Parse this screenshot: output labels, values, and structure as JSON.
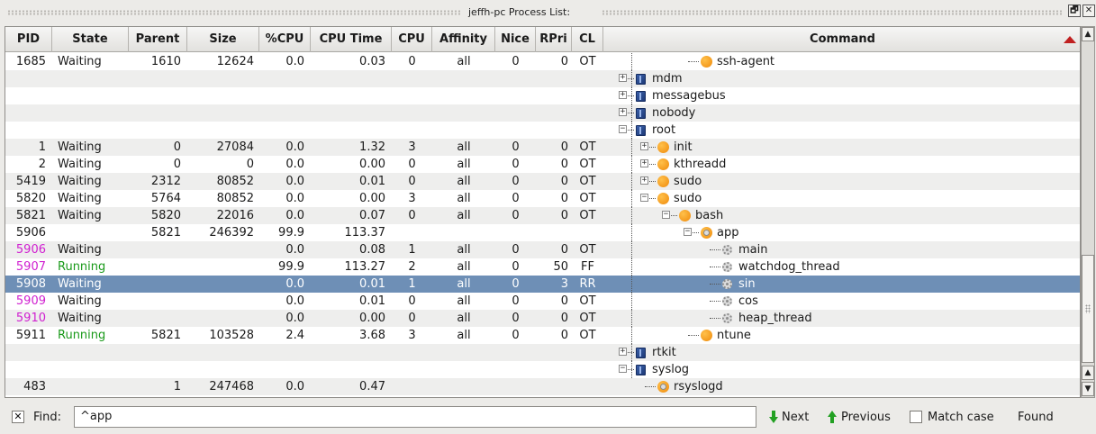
{
  "window": {
    "title": "jeffh-pc Process List:",
    "float_glyph": "🗗",
    "close_glyph": "✕"
  },
  "columns": [
    "PID",
    "State",
    "Parent",
    "Size",
    "%CPU",
    "CPU Time",
    "CPU",
    "Affinity",
    "Nice",
    "RPri",
    "CL",
    "Command"
  ],
  "sort": {
    "column": "Command",
    "direction": "descending",
    "indicator_color": "#c02020"
  },
  "rows": [
    {
      "pid": "1685",
      "state": "Waiting",
      "parent": "1610",
      "size": "12624",
      "cpu_pct": "0.0",
      "cpu_time": "0.03",
      "cpu": "0",
      "affinity": "all",
      "nice": "0",
      "rpri": "0",
      "cl": "OT",
      "command": "ssh-agent",
      "depth": 3,
      "icon": "process",
      "expander": "",
      "pid_color": "",
      "state_color": ""
    },
    {
      "pid": "",
      "state": "",
      "parent": "",
      "size": "",
      "cpu_pct": "",
      "cpu_time": "",
      "cpu": "",
      "affinity": "",
      "nice": "",
      "rpri": "",
      "cl": "",
      "command": "mdm",
      "depth": 0,
      "icon": "user",
      "expander": "+",
      "pid_color": "",
      "state_color": ""
    },
    {
      "pid": "",
      "state": "",
      "parent": "",
      "size": "",
      "cpu_pct": "",
      "cpu_time": "",
      "cpu": "",
      "affinity": "",
      "nice": "",
      "rpri": "",
      "cl": "",
      "command": "messagebus",
      "depth": 0,
      "icon": "user",
      "expander": "+",
      "pid_color": "",
      "state_color": ""
    },
    {
      "pid": "",
      "state": "",
      "parent": "",
      "size": "",
      "cpu_pct": "",
      "cpu_time": "",
      "cpu": "",
      "affinity": "",
      "nice": "",
      "rpri": "",
      "cl": "",
      "command": "nobody",
      "depth": 0,
      "icon": "user",
      "expander": "+",
      "pid_color": "",
      "state_color": ""
    },
    {
      "pid": "",
      "state": "",
      "parent": "",
      "size": "",
      "cpu_pct": "",
      "cpu_time": "",
      "cpu": "",
      "affinity": "",
      "nice": "",
      "rpri": "",
      "cl": "",
      "command": "root",
      "depth": 0,
      "icon": "user",
      "expander": "-",
      "pid_color": "",
      "state_color": ""
    },
    {
      "pid": "1",
      "state": "Waiting",
      "parent": "0",
      "size": "27084",
      "cpu_pct": "0.0",
      "cpu_time": "1.32",
      "cpu": "3",
      "affinity": "all",
      "nice": "0",
      "rpri": "0",
      "cl": "OT",
      "command": "init",
      "depth": 1,
      "icon": "process",
      "expander": "+",
      "pid_color": "",
      "state_color": ""
    },
    {
      "pid": "2",
      "state": "Waiting",
      "parent": "0",
      "size": "0",
      "cpu_pct": "0.0",
      "cpu_time": "0.00",
      "cpu": "0",
      "affinity": "all",
      "nice": "0",
      "rpri": "0",
      "cl": "OT",
      "command": "kthreadd",
      "depth": 1,
      "icon": "process",
      "expander": "+",
      "pid_color": "",
      "state_color": ""
    },
    {
      "pid": "5419",
      "state": "Waiting",
      "parent": "2312",
      "size": "80852",
      "cpu_pct": "0.0",
      "cpu_time": "0.01",
      "cpu": "0",
      "affinity": "all",
      "nice": "0",
      "rpri": "0",
      "cl": "OT",
      "command": "sudo",
      "depth": 1,
      "icon": "process",
      "expander": "+",
      "pid_color": "",
      "state_color": ""
    },
    {
      "pid": "5820",
      "state": "Waiting",
      "parent": "5764",
      "size": "80852",
      "cpu_pct": "0.0",
      "cpu_time": "0.00",
      "cpu": "3",
      "affinity": "all",
      "nice": "0",
      "rpri": "0",
      "cl": "OT",
      "command": "sudo",
      "depth": 1,
      "icon": "process",
      "expander": "-",
      "pid_color": "",
      "state_color": ""
    },
    {
      "pid": "5821",
      "state": "Waiting",
      "parent": "5820",
      "size": "22016",
      "cpu_pct": "0.0",
      "cpu_time": "0.07",
      "cpu": "0",
      "affinity": "all",
      "nice": "0",
      "rpri": "0",
      "cl": "OT",
      "command": "bash",
      "depth": 2,
      "icon": "process",
      "expander": "-",
      "pid_color": "",
      "state_color": ""
    },
    {
      "pid": "5906",
      "state": "",
      "parent": "5821",
      "size": "246392",
      "cpu_pct": "99.9",
      "cpu_time": "113.37",
      "cpu": "",
      "affinity": "",
      "nice": "",
      "rpri": "",
      "cl": "",
      "command": "app",
      "depth": 3,
      "icon": "process-gear",
      "expander": "-",
      "pid_color": "",
      "state_color": ""
    },
    {
      "pid": "5906",
      "state": "Waiting",
      "parent": "",
      "size": "",
      "cpu_pct": "0.0",
      "cpu_time": "0.08",
      "cpu": "1",
      "affinity": "all",
      "nice": "0",
      "rpri": "0",
      "cl": "OT",
      "command": "main",
      "depth": 4,
      "icon": "thread",
      "expander": "",
      "pid_color": "#d020d0",
      "state_color": ""
    },
    {
      "pid": "5907",
      "state": "Running",
      "parent": "",
      "size": "",
      "cpu_pct": "99.9",
      "cpu_time": "113.27",
      "cpu": "2",
      "affinity": "all",
      "nice": "0",
      "rpri": "50",
      "cl": "FF",
      "command": "watchdog_thread",
      "depth": 4,
      "icon": "thread",
      "expander": "",
      "pid_color": "#d020d0",
      "state_color": "#1a9a1a"
    },
    {
      "pid": "5908",
      "state": "Waiting",
      "parent": "",
      "size": "",
      "cpu_pct": "0.0",
      "cpu_time": "0.01",
      "cpu": "1",
      "affinity": "all",
      "nice": "0",
      "rpri": "3",
      "cl": "RR",
      "command": "sin",
      "depth": 4,
      "icon": "thread",
      "expander": "",
      "pid_color": "#d020d0",
      "state_color": "",
      "selected": true
    },
    {
      "pid": "5909",
      "state": "Waiting",
      "parent": "",
      "size": "",
      "cpu_pct": "0.0",
      "cpu_time": "0.01",
      "cpu": "0",
      "affinity": "all",
      "nice": "0",
      "rpri": "0",
      "cl": "OT",
      "command": "cos",
      "depth": 4,
      "icon": "thread",
      "expander": "",
      "pid_color": "#d020d0",
      "state_color": ""
    },
    {
      "pid": "5910",
      "state": "Waiting",
      "parent": "",
      "size": "",
      "cpu_pct": "0.0",
      "cpu_time": "0.00",
      "cpu": "0",
      "affinity": "all",
      "nice": "0",
      "rpri": "0",
      "cl": "OT",
      "command": "heap_thread",
      "depth": 4,
      "icon": "thread",
      "expander": "",
      "pid_color": "#d020d0",
      "state_color": ""
    },
    {
      "pid": "5911",
      "state": "Running",
      "parent": "5821",
      "size": "103528",
      "cpu_pct": "2.4",
      "cpu_time": "3.68",
      "cpu": "3",
      "affinity": "all",
      "nice": "0",
      "rpri": "0",
      "cl": "OT",
      "command": "ntune",
      "depth": 3,
      "icon": "process",
      "expander": "",
      "pid_color": "",
      "state_color": "#1a9a1a"
    },
    {
      "pid": "",
      "state": "",
      "parent": "",
      "size": "",
      "cpu_pct": "",
      "cpu_time": "",
      "cpu": "",
      "affinity": "",
      "nice": "",
      "rpri": "",
      "cl": "",
      "command": "rtkit",
      "depth": 0,
      "icon": "user",
      "expander": "+",
      "pid_color": "",
      "state_color": ""
    },
    {
      "pid": "",
      "state": "",
      "parent": "",
      "size": "",
      "cpu_pct": "",
      "cpu_time": "",
      "cpu": "",
      "affinity": "",
      "nice": "",
      "rpri": "",
      "cl": "",
      "command": "syslog",
      "depth": 0,
      "icon": "user",
      "expander": "-",
      "pid_color": "",
      "state_color": ""
    },
    {
      "pid": "483",
      "state": "",
      "parent": "1",
      "size": "247468",
      "cpu_pct": "0.0",
      "cpu_time": "0.47",
      "cpu": "",
      "affinity": "",
      "nice": "",
      "rpri": "",
      "cl": "",
      "command": "rsyslogd",
      "depth": 1,
      "icon": "process-gear",
      "expander": "",
      "pid_color": "",
      "state_color": ""
    }
  ],
  "find": {
    "close_glyph": "✕",
    "label": "Find:",
    "value": "^app",
    "next_label": "Next",
    "previous_label": "Previous",
    "match_case_label": "Match case",
    "status": "Found"
  },
  "colors": {
    "selection": "#6e8fb6",
    "running": "#1a9a1a",
    "thread_pid": "#d020d0",
    "nav_arrow": "#22a022"
  }
}
